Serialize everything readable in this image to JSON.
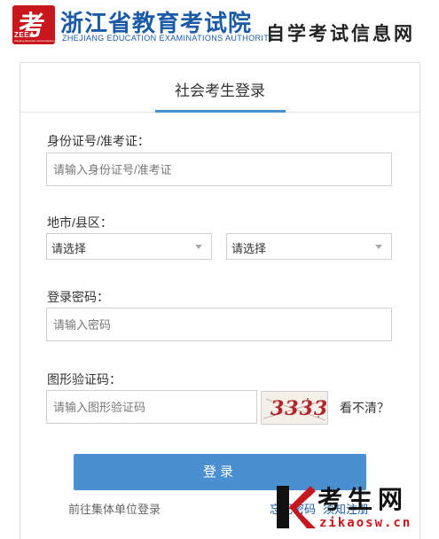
{
  "header": {
    "logo_char": "考",
    "logo_text": "ZEEA",
    "logo_sub": "Zhejiang Education Examinations Authority",
    "org_title": "浙江省教育考试院",
    "org_subtitle": "ZHEJIANG EDUCATION EXAMINATIONS AUTHORITY",
    "site_name": "自学考试信息网"
  },
  "tab": {
    "label": "社会考生登录"
  },
  "form": {
    "id_label": "身份证号/准考证：",
    "id_placeholder": "请输入身份证号/准考证",
    "region_label": "地市/县区：",
    "city_value": "请选择",
    "county_value": "请选择",
    "password_label": "登录密码：",
    "password_placeholder": "请输入密码",
    "captcha_label": "图形验证码：",
    "captcha_placeholder": "请输入图形验证码",
    "captcha_text": "3333",
    "captcha_refresh": "看不清？",
    "login_button": "登录"
  },
  "links": {
    "group_login": "前往集体单位登录",
    "forgot_password": "忘记密码",
    "notice": "须知注册"
  },
  "watermark": {
    "brand": "考生网",
    "url": "zikaosw.cn"
  },
  "colors": {
    "accent": "#4a90d0",
    "brand_blue": "#1a5aa6",
    "brand_red": "#c8161d"
  }
}
